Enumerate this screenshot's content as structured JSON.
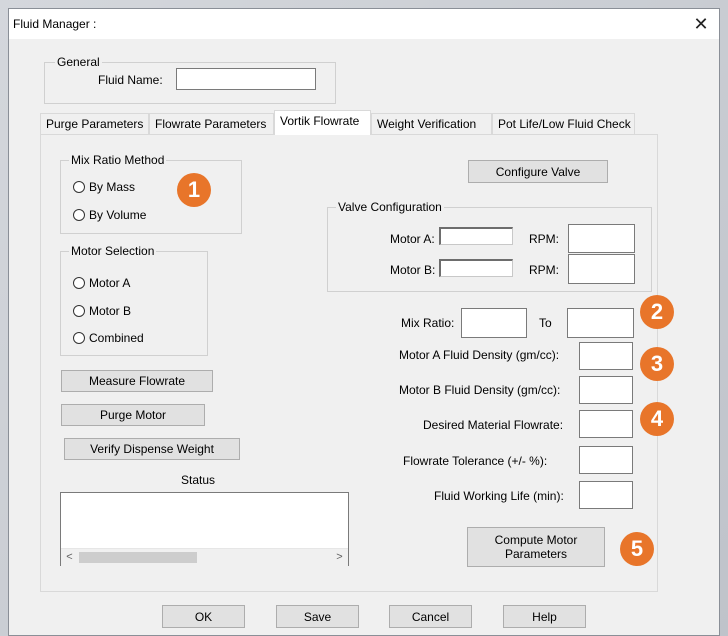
{
  "window": {
    "title": "Fluid Manager :",
    "close_glyph": "✕"
  },
  "general": {
    "group_label": "General",
    "fluid_name_label": "Fluid Name:",
    "fluid_name_value": ""
  },
  "tabs": [
    {
      "label": "Purge Parameters",
      "active": false
    },
    {
      "label": "Flowrate Parameters",
      "active": false
    },
    {
      "label": "Vortik Flowrate",
      "active": true
    },
    {
      "label": "Weight Verification",
      "active": false
    },
    {
      "label": "Pot Life/Low Fluid Check",
      "active": false
    }
  ],
  "mix_ratio_method": {
    "group_label": "Mix Ratio Method",
    "options": [
      "By Mass",
      "By Volume"
    ]
  },
  "motor_selection": {
    "group_label": "Motor Selection",
    "options": [
      "Motor A",
      "Motor B",
      "Combined"
    ]
  },
  "buttons": {
    "configure_valve": "Configure Valve",
    "measure_flowrate": "Measure Flowrate",
    "purge_motor": "Purge Motor",
    "verify_dispense_weight": "Verify Dispense Weight",
    "compute_motor_parameters": "Compute Motor Parameters",
    "ok": "OK",
    "save": "Save",
    "cancel": "Cancel",
    "help": "Help"
  },
  "valve_configuration": {
    "group_label": "Valve Configuration",
    "motor_a_label": "Motor A:",
    "motor_b_label": "Motor B:",
    "rpm_label": "RPM:"
  },
  "fields": {
    "mix_ratio_label": "Mix Ratio:",
    "to_label": "To",
    "motor_a_density_label": "Motor A Fluid Density (gm/cc):",
    "motor_b_density_label": "Motor B Fluid Density (gm/cc):",
    "desired_flowrate_label": "Desired Material Flowrate:",
    "flowrate_tolerance_label": "Flowrate Tolerance (+/- %):",
    "fluid_working_life_label": "Fluid Working Life (min):"
  },
  "status": {
    "label": "Status"
  },
  "scrollbar": {
    "left_arrow": "<",
    "right_arrow": ">"
  },
  "badges": [
    "1",
    "2",
    "3",
    "4",
    "5"
  ],
  "colors": {
    "badge": "#e8752a",
    "window_bg": "#f0f0f0"
  }
}
